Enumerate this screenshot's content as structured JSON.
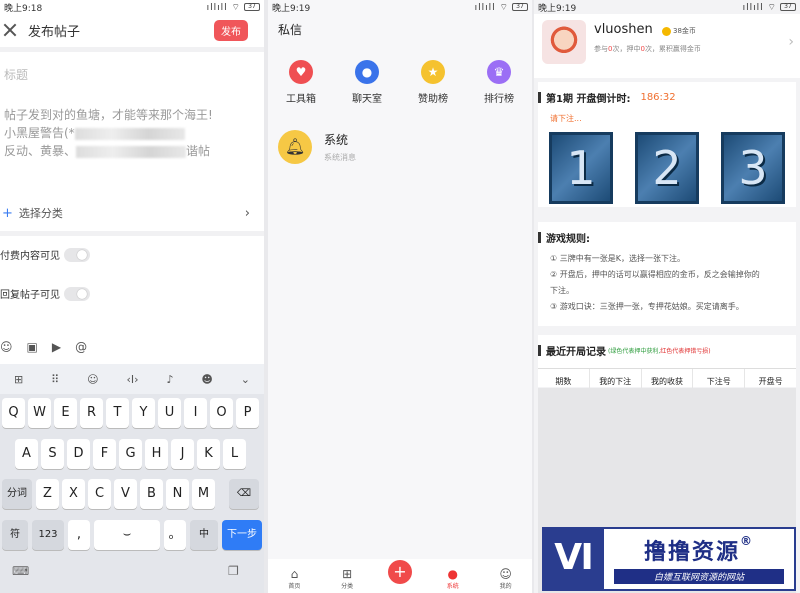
{
  "status": {
    "time": "晚上9:18",
    "time2": "晚上9:19",
    "battery": "37"
  },
  "compose": {
    "title": "发布帖子",
    "publish": "发布",
    "title_placeholder": "标题",
    "body_line1": "帖子发到对的鱼塘，才能等来那个海王!",
    "body_line2": "小黑屋警告(*",
    "body_line3": "反动、黄暴、",
    "body_line3_end": "谐帖",
    "category": "选择分类",
    "toggle1": "付费内容可见",
    "toggle2": "回复帖子可见"
  },
  "keyboard": {
    "row1": [
      "Q",
      "W",
      "E",
      "R",
      "T",
      "Y",
      "U",
      "I",
      "O",
      "P"
    ],
    "row2": [
      "A",
      "S",
      "D",
      "F",
      "G",
      "H",
      "J",
      "K",
      "L"
    ],
    "row3": [
      "Z",
      "X",
      "C",
      "V",
      "B",
      "N",
      "M"
    ],
    "fen": "分词",
    "fu": "符",
    "num": "123",
    "comma": ",",
    "dot": "。",
    "zhong": "中",
    "next": "下一步"
  },
  "messages": {
    "title": "私信",
    "icons": [
      {
        "label": "工具箱",
        "color": "#ef4f52",
        "icon": "heart-icon"
      },
      {
        "label": "聊天室",
        "color": "#3a73ea",
        "icon": "chat-icon"
      },
      {
        "label": "赞助榜",
        "color": "#f5c22f",
        "icon": "star-icon"
      },
      {
        "label": "排行榜",
        "color": "#9b6ef5",
        "icon": "trophy-icon"
      }
    ],
    "system_name": "系统",
    "system_sub": "系统消息",
    "tabs": [
      "首页",
      "分类",
      "",
      "系统",
      "我的"
    ]
  },
  "game": {
    "username": "vluoshen",
    "coins": "38金币",
    "stats_prefix": "参与",
    "stats_participate": "0",
    "stats_mid1": "次，押中",
    "stats_win": "0",
    "stats_mid2": "次，累积赢得金币",
    "round_label": "第1期 开盘倒计时:",
    "countdown": "186:32",
    "please_bet": "请下注...",
    "cards": [
      "1",
      "2",
      "3"
    ],
    "rules_title": "游戏规则:",
    "rules": [
      "① 三牌中有一张是K，选择一张下注。",
      "② 开盘后，押中的话可以赢得相应的金币，反之会输掉你的",
      "下注。",
      "③ 游戏口诀：三张押一张，专押花姑娘。买定请离手。"
    ],
    "records_title": "最近开局记录",
    "legend_green": "(绿色代表押中获利,",
    "legend_red": "红色代表押错亏损)",
    "columns": [
      "期数",
      "我的下注",
      "我的收获",
      "下注号",
      "开盘号"
    ]
  },
  "watermark": {
    "main": "撸撸资源",
    "reg": "®",
    "sub": "白嫖互联网资源的网站"
  }
}
